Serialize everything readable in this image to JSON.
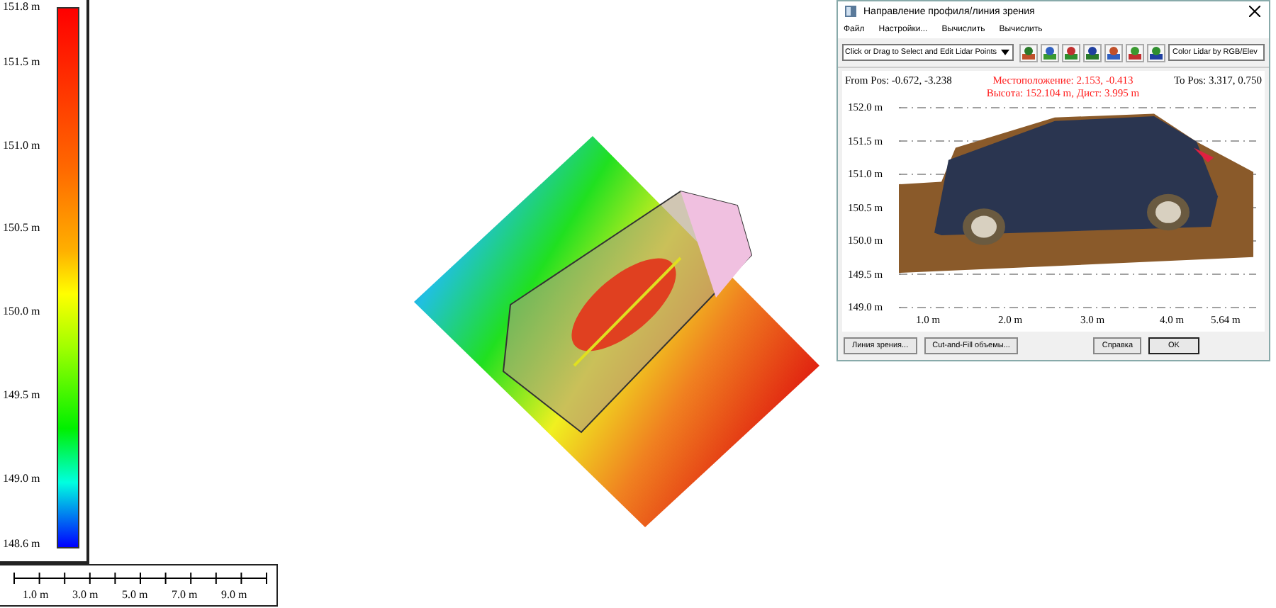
{
  "legend": {
    "labels": [
      "151.8 m",
      "151.5 m",
      "151.0 m",
      "150.5 m",
      "150.0 m",
      "149.5 m",
      "149.0 m",
      "148.6 m"
    ]
  },
  "scale_bar": {
    "labels": [
      "1.0 m",
      "3.0 m",
      "5.0 m",
      "7.0 m",
      "9.0 m"
    ]
  },
  "dialog": {
    "title": "Направление профиля/линия зрения",
    "menu": [
      "Файл",
      "Настройки...",
      "Вычислить",
      "Вычислить"
    ],
    "mode_select": "Click or Drag to Select and Edit Lidar Points",
    "color_mode": "Color Lidar by RGB/Elev",
    "from_pos": "From Pos: -0.672, -3.238",
    "location": "Местоположение: 2.153, -0.413",
    "height": "Высота: 152.104 m, Дист: 3.995 m",
    "to_pos": "To Pos: 3.317, 0.750",
    "y_labels": [
      "152.0 m",
      "151.5 m",
      "151.0 m",
      "150.5 m",
      "150.0 m",
      "149.5 m",
      "149.0 m"
    ],
    "x_labels": [
      "1.0 m",
      "2.0 m",
      "3.0 m",
      "4.0 m",
      "5.64 m"
    ],
    "buttons": [
      "Линия зрения...",
      "Cut-and-Fill объемы...",
      "Справка",
      "OK"
    ]
  }
}
